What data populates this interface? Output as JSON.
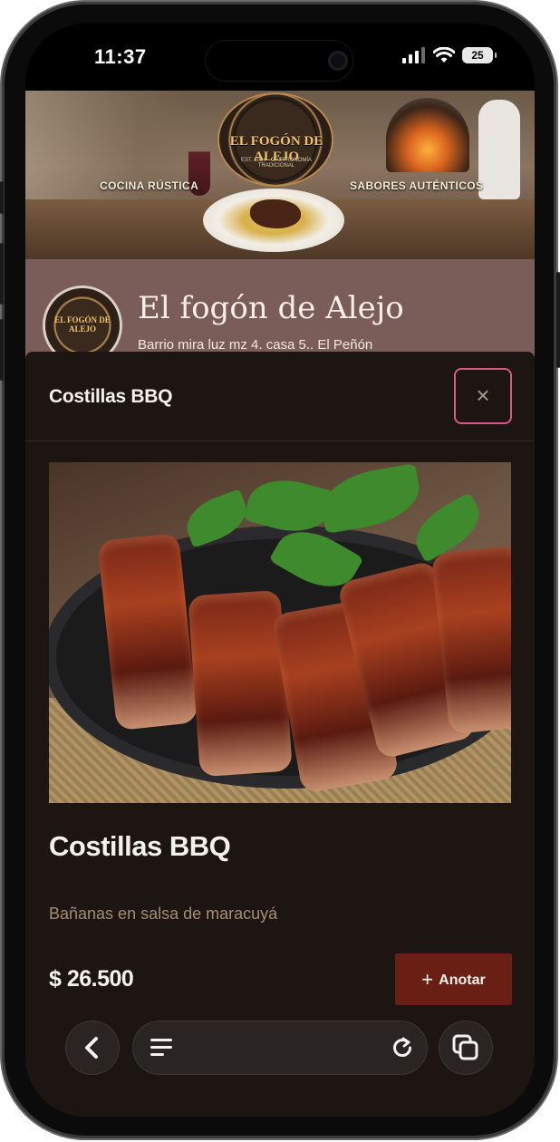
{
  "status_bar": {
    "time": "11:37",
    "battery": "25"
  },
  "restaurant": {
    "banner_title": "EL FOGÓN DE ALEJO",
    "banner_sub": "EST. 2024 · GASTRONOMÍA TRADICIONAL",
    "tag_left": "COCINA RÚSTICA",
    "tag_right": "SABORES AUTÉNTICOS",
    "logo_text": "EL FOGÓN DE ALEJO",
    "name": "El fogón de Alejo",
    "address": "Barrio mira luz mz 4. casa 5.. El Peñón"
  },
  "modal": {
    "header_title": "Costillas BBQ",
    "close_glyph": "×",
    "dish_name": "Costillas BBQ",
    "description": "Bañanas en salsa de maracuyá",
    "price": "$ 26.500",
    "add_label": "Anotar",
    "add_glyph": "+"
  },
  "browser": {
    "back_glyph": "‹"
  },
  "icons": {
    "signal": "cellular-signal-icon",
    "wifi": "wifi-icon",
    "battery": "battery-icon",
    "close": "close-icon",
    "back": "chevron-left-icon",
    "menu": "menu-icon",
    "reload": "reload-icon",
    "tabs": "tabs-icon"
  },
  "colors": {
    "modal_bg": "#1c1512",
    "accent_button": "#6a1f14",
    "close_border": "#d45a86",
    "band": "#7a5c58",
    "description_text": "#a48d72"
  }
}
